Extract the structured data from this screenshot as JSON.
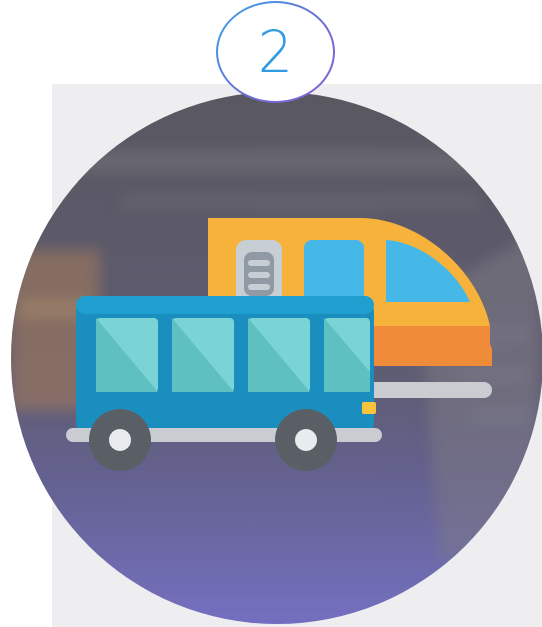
{
  "step": {
    "number": "2"
  },
  "illustration": {
    "subject": "bus-and-train-icon",
    "background": "blurred-subway-platform-photo"
  },
  "colors": {
    "badge_text": "#2f9be0",
    "badge_ring_start": "#3aa7e6",
    "badge_ring_end": "#8a5fd0",
    "overlay_top": "#5e5c66",
    "overlay_bottom": "#6e6bc2",
    "bus_body": "#1a8fbf",
    "bus_window": "#7ad3d4",
    "train_body": "#f7b23b",
    "train_nose": "#f08b3a",
    "train_window": "#45b8e8"
  }
}
